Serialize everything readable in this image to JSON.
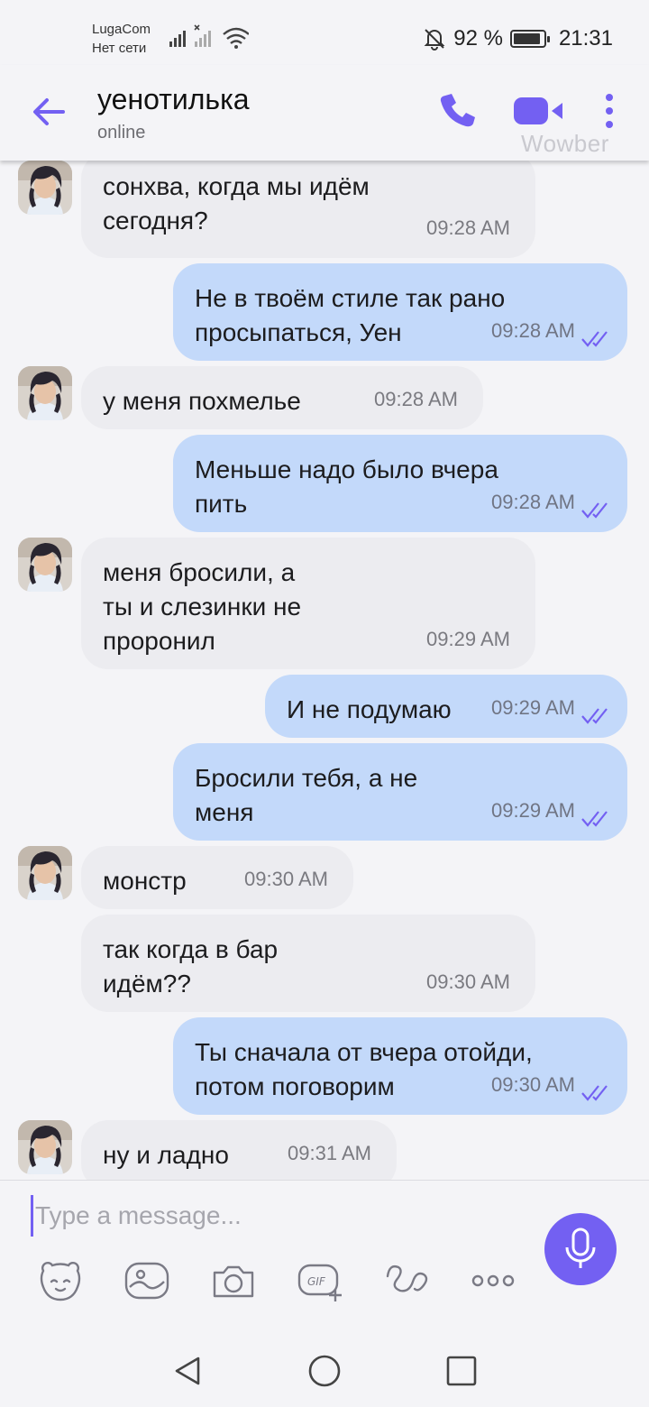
{
  "status_bar": {
    "carrier": "LugaCom",
    "network_status": "Нет сети",
    "battery_percent": "92 %",
    "battery_level": 0.92,
    "time": "21:31"
  },
  "header": {
    "contact_name": "уенотилька",
    "contact_status": "online",
    "watermark": "Wowber"
  },
  "messages": [
    {
      "direction": "in",
      "avatar": true,
      "text": "сонхва, когда мы идём\nсегодня?",
      "time": "09:28 AM"
    },
    {
      "direction": "out",
      "avatar": false,
      "text": "Не в твоём стиле так рано\nпросыпаться, Уен",
      "time": "09:28 AM"
    },
    {
      "direction": "in",
      "avatar": true,
      "text": "у меня похмелье",
      "time": "09:28 AM"
    },
    {
      "direction": "out",
      "avatar": false,
      "text": "Меньше надо было вчера\nпить",
      "time": "09:28 AM"
    },
    {
      "direction": "in",
      "avatar": true,
      "text": "меня бросили, а\nты и слезинки не\nпроронил",
      "time": "09:29 AM"
    },
    {
      "direction": "out",
      "avatar": false,
      "text": "И не подумаю",
      "time": "09:29 AM"
    },
    {
      "direction": "out",
      "avatar": false,
      "text": "Бросили тебя, а не\nменя",
      "time": "09:29 AM"
    },
    {
      "direction": "in",
      "avatar": true,
      "text": "монстр",
      "time": "09:30 AM"
    },
    {
      "direction": "in",
      "avatar": false,
      "text": "так когда в бар\nидём??",
      "time": "09:30 AM"
    },
    {
      "direction": "out",
      "avatar": false,
      "text": "Ты сначала от вчера отойди,\nпотом поговорим",
      "time": "09:30 AM"
    },
    {
      "direction": "in",
      "avatar": true,
      "text": "ну и ладно",
      "time": "09:31 AM"
    }
  ],
  "composer": {
    "placeholder": "Type a message...",
    "tools": [
      "sticker-icon",
      "image-icon",
      "camera-icon",
      "gif-icon",
      "doodle-icon",
      "more-options-icon"
    ]
  },
  "colors": {
    "accent": "#7360f2",
    "incoming_bubble": "#ececf0",
    "outgoing_bubble": "#c3d9fa"
  }
}
